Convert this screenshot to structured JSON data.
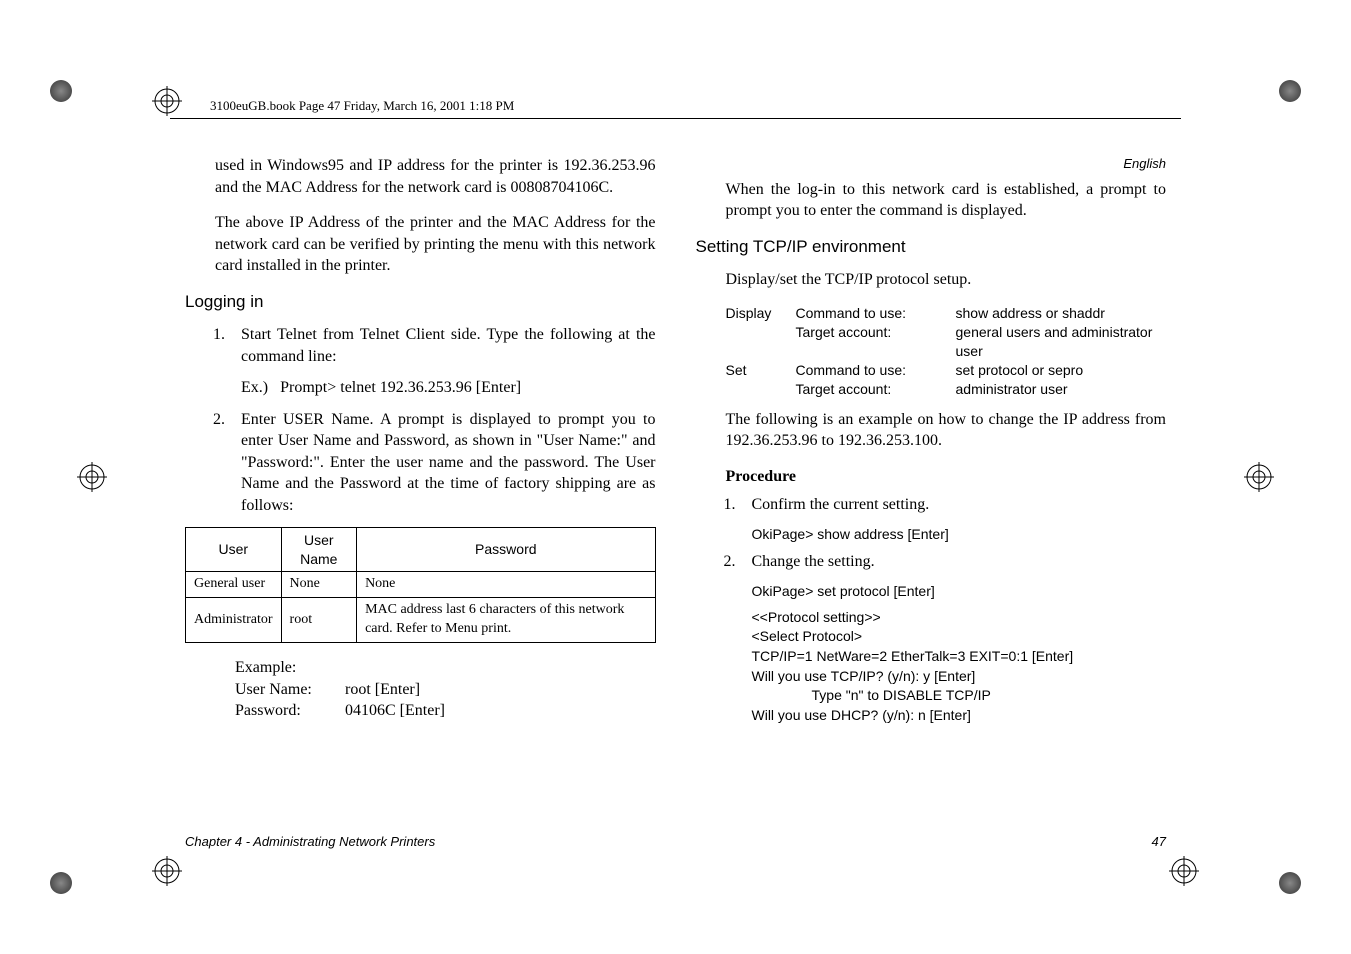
{
  "header_text": "3100euGB.book  Page 47  Friday, March 16, 2001  1:18 PM",
  "lang_label": "English",
  "left": {
    "para1": "used in Windows95 and IP address for the printer is 192.36.253.96 and the MAC Address for the network card is 00808704106C.",
    "para2": "The above IP Address of the printer and the MAC Address for the network card can be verified by printing the menu with this network card installed in the printer.",
    "heading_login": "Logging in",
    "item1_num": "1.",
    "item1_text": "Start Telnet from Telnet Client side. Type the following at the command line:",
    "item1_ex_label": "Ex.)",
    "item1_ex_cmd": "Prompt> telnet 192.36.253.96 [Enter]",
    "item2_num": "2.",
    "item2_text": "Enter USER Name. A prompt is displayed to prompt you to enter User Name and Password, as shown in \"User Name:\" and \"Password:\". Enter the user name and the password. The User Name and the Password at the time of factory shipping are as follows:",
    "table": {
      "h1": "User",
      "h2": "User Name",
      "h3": "Password",
      "r1c1": "General user",
      "r1c2": "None",
      "r1c3": "None",
      "r2c1": "Administrator",
      "r2c2": "root",
      "r2c3": "MAC address last 6 characters of this network card. Refer to Menu print."
    },
    "example_label": "Example:",
    "example_user_label": "User Name:",
    "example_user_val": "root [Enter]",
    "example_pass_label": "Password:",
    "example_pass_val": "04106C [Enter]"
  },
  "right": {
    "para1": "When the log-in to this network card is established, a prompt to prompt you to enter the command is displayed.",
    "heading_tcpip": "Setting TCP/IP environment",
    "para2": "Display/set the TCP/IP protocol setup.",
    "cmd": {
      "r1c1": "Display",
      "r1c2": "Command to use:",
      "r1c3": "show address or shaddr",
      "r2c2": "Target account:",
      "r2c3": "general users and administrator user",
      "r3c1": "Set",
      "r3c2": "Command to use:",
      "r3c3": "set protocol or sepro",
      "r4c2": "Target account:",
      "r4c3": "administrator user"
    },
    "para3": "The following is an example on how to change the IP address from 192.36.253.96 to 192.36.253.100.",
    "procedure_label": "Procedure",
    "p1_num": "1.",
    "p1_text": "Confirm the current setting.",
    "p1_cmd": "OkiPage> show address [Enter]",
    "p2_num": "2.",
    "p2_text": "Change the setting.",
    "p2_cmd": "OkiPage> set protocol [Enter]",
    "proto_block": {
      "l1": "<<Protocol setting>>",
      "l2": "<Select Protocol>",
      "l3": "TCP/IP=1 NetWare=2 EtherTalk=3 EXIT=0:1 [Enter]",
      "l4": "Will you use TCP/IP? (y/n): y [Enter]",
      "l5": "Type \"n\" to DISABLE TCP/IP",
      "l6": "Will you use DHCP? (y/n): n [Enter]"
    }
  },
  "footer_left": "Chapter 4 - Administrating Network Printers",
  "footer_right": "47"
}
